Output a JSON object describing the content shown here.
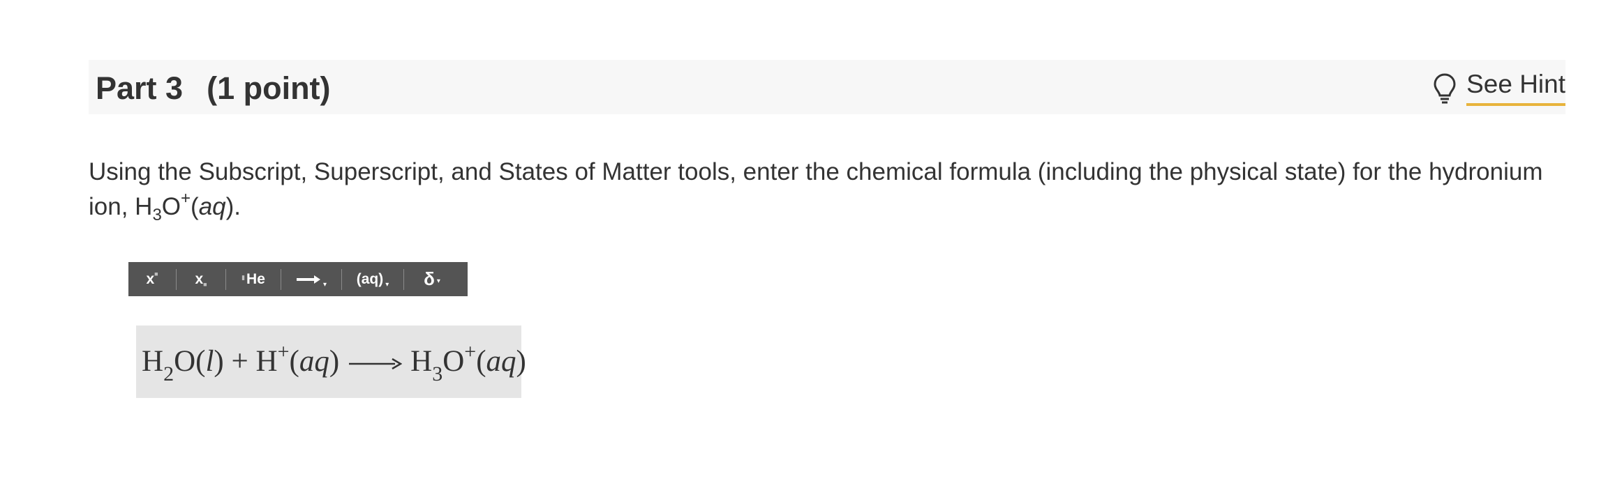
{
  "part": {
    "title": "Part 3",
    "points": "(1 point)"
  },
  "hint": {
    "label": "See Hint",
    "icon": "lightbulb-icon"
  },
  "question": {
    "text": "Using the Subscript, Superscript, and States of Matter tools, enter the chemical formula (including the physical state) for the hydronium ion, ",
    "formula_h": "H",
    "formula_sub": "3",
    "formula_o": "O",
    "formula_sup": "+",
    "state_open": "(",
    "state": "aq",
    "state_close": ")."
  },
  "toolbar": {
    "superscript_label": "x",
    "subscript_label": "x",
    "element_label": "He",
    "states_label": "(aq)",
    "delta_label": "δ"
  },
  "answer": {
    "r1_element_h": "H",
    "r1_sub": "2",
    "r1_element_o": "O",
    "r1_state_open": "(",
    "r1_state": "l",
    "r1_state_close": ")",
    "plus": "+",
    "r2_element": "H",
    "r2_sup": "+",
    "r2_state_open": "(",
    "r2_state": "aq",
    "r2_state_close": ")",
    "p_element_h": "H",
    "p_sub": "3",
    "p_element_o": "O",
    "p_sup": "+",
    "p_state_open": "(",
    "p_state": "aq",
    "p_state_close": ")"
  },
  "colors": {
    "header_bg": "#f7f7f7",
    "hint_underline": "#e8b33c",
    "toolbar_bg": "#545454",
    "answer_bg": "#e5e5e5",
    "text": "#333333"
  }
}
